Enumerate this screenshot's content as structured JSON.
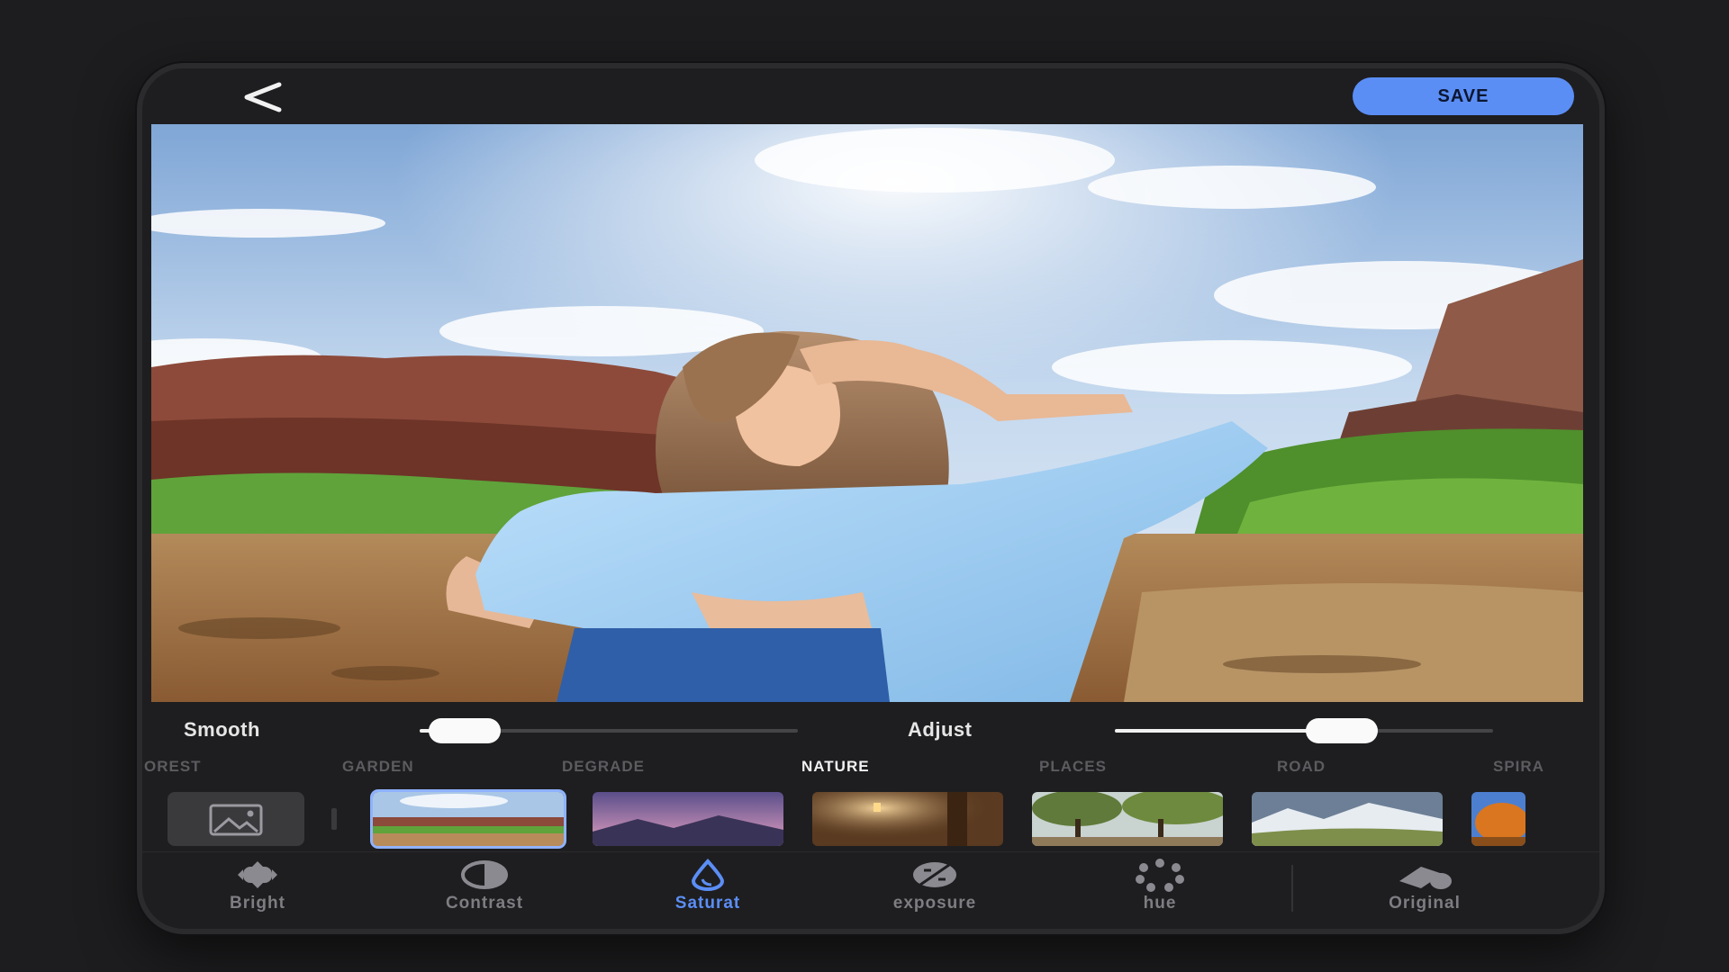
{
  "header": {
    "back_icon": "chevron-left-icon",
    "save_label": "SAVE",
    "accent_color": "#5b8ef5"
  },
  "sliders": {
    "smooth": {
      "label": "Smooth",
      "value": 0.12
    },
    "adjust": {
      "label": "Adjust",
      "value": 0.6
    }
  },
  "categories": [
    {
      "label": "OREST",
      "active": false
    },
    {
      "label": "GARDEN",
      "active": false
    },
    {
      "label": "DEGRADE",
      "active": false
    },
    {
      "label": "NATURE",
      "active": true
    },
    {
      "label": "PLACES",
      "active": false
    },
    {
      "label": "ROAD",
      "active": false
    },
    {
      "label": "SPIRA",
      "active": false
    }
  ],
  "backgrounds": [
    {
      "name": "red-rock-desert",
      "selected": true
    },
    {
      "name": "purple-mountain-dusk",
      "selected": false
    },
    {
      "name": "lantern-forest",
      "selected": false
    },
    {
      "name": "park-trees",
      "selected": false
    },
    {
      "name": "snowy-valley",
      "selected": false
    },
    {
      "name": "autumn-tree",
      "selected": false
    }
  ],
  "tools": [
    {
      "label": "Bright",
      "icon": "sun-icon",
      "active": false
    },
    {
      "label": "Contrast",
      "icon": "contrast-icon",
      "active": false
    },
    {
      "label": "Saturat",
      "icon": "droplet-icon",
      "active": true
    },
    {
      "label": "exposure",
      "icon": "exposure-icon",
      "active": false
    },
    {
      "label": "hue",
      "icon": "hue-dots-icon",
      "active": false
    },
    {
      "label": "Original",
      "icon": "original-icon",
      "active": false
    }
  ]
}
